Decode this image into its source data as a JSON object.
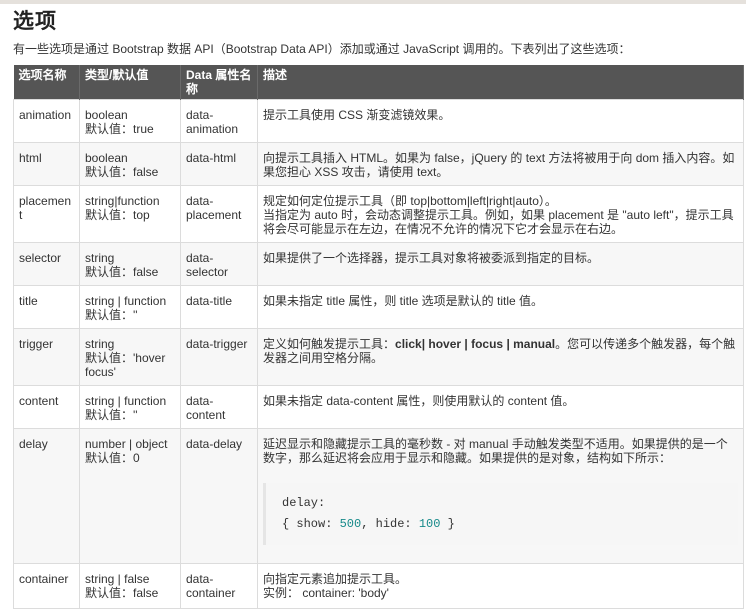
{
  "page": {
    "title": "选项",
    "intro": "有一些选项是通过 Bootstrap 数据 API（Bootstrap Data API）添加或通过 JavaScript 调用的。下表列出了这些选项："
  },
  "table": {
    "headers": [
      "选项名称",
      "类型/默认值",
      "Data 属性名称",
      "描述"
    ],
    "rows": [
      {
        "name": "animation",
        "type": "boolean",
        "default": "默认值：true",
        "data_attr": "data-animation",
        "desc": [
          "提示工具使用 CSS 渐变滤镜效果。"
        ]
      },
      {
        "name": "html",
        "type": "boolean",
        "default": "默认值：false",
        "data_attr": "data-html",
        "desc": [
          "向提示工具插入 HTML。如果为 false，jQuery 的 text 方法将被用于向 dom 插入内容。如果您担心 XSS 攻击，请使用 text。"
        ]
      },
      {
        "name": "placement",
        "type": "string|function",
        "default": "默认值：top",
        "data_attr": "data-placement",
        "desc": [
          "规定如何定位提示工具（即 top|bottom|left|right|auto）。",
          "当指定为 auto 时，会动态调整提示工具。例如，如果 placement 是 \"auto left\"，提示工具将会尽可能显示在左边，在情况不允许的情况下它才会显示在右边。"
        ]
      },
      {
        "name": "selector",
        "type": "string",
        "default": "默认值：false",
        "data_attr": "data-selector",
        "desc": [
          "如果提供了一个选择器，提示工具对象将被委派到指定的目标。"
        ]
      },
      {
        "name": "title",
        "type": "string | function",
        "default": "默认值：''",
        "data_attr": "data-title",
        "desc": [
          "如果未指定 title 属性，则 title 选项是默认的 title 值。"
        ]
      },
      {
        "name": "trigger",
        "type": "string",
        "default": "默认值：'hover focus'",
        "data_attr": "data-trigger",
        "desc_prefix": "定义如何触发提示工具：",
        "desc_bold": "click| hover | focus | manual",
        "desc_suffix": "。您可以传递多个触发器，每个触发器之间用空格分隔。"
      },
      {
        "name": "content",
        "type": "string | function",
        "default": "默认值：''",
        "data_attr": "data-content",
        "desc": [
          "如果未指定 data-content 属性，则使用默认的 content 值。"
        ]
      },
      {
        "name": "delay",
        "type": "number | object",
        "default": "默认值：0",
        "data_attr": "data-delay",
        "desc": [
          "延迟显示和隐藏提示工具的毫秒数 - 对 manual 手动触发类型不适用。如果提供的是一个数字，那么延迟将会应用于显示和隐藏。如果提供的是对象，结构如下所示："
        ],
        "code_line1": "delay:",
        "code_open": "{ show: ",
        "code_show": "500",
        "code_mid": ", hide: ",
        "code_hide": "100",
        "code_close": " }"
      },
      {
        "name": "container",
        "type": "string | false",
        "default": "默认值：false",
        "data_attr": "data-container",
        "desc": [
          "向指定元素追加提示工具。",
          "实例： container: 'body'"
        ]
      }
    ]
  }
}
